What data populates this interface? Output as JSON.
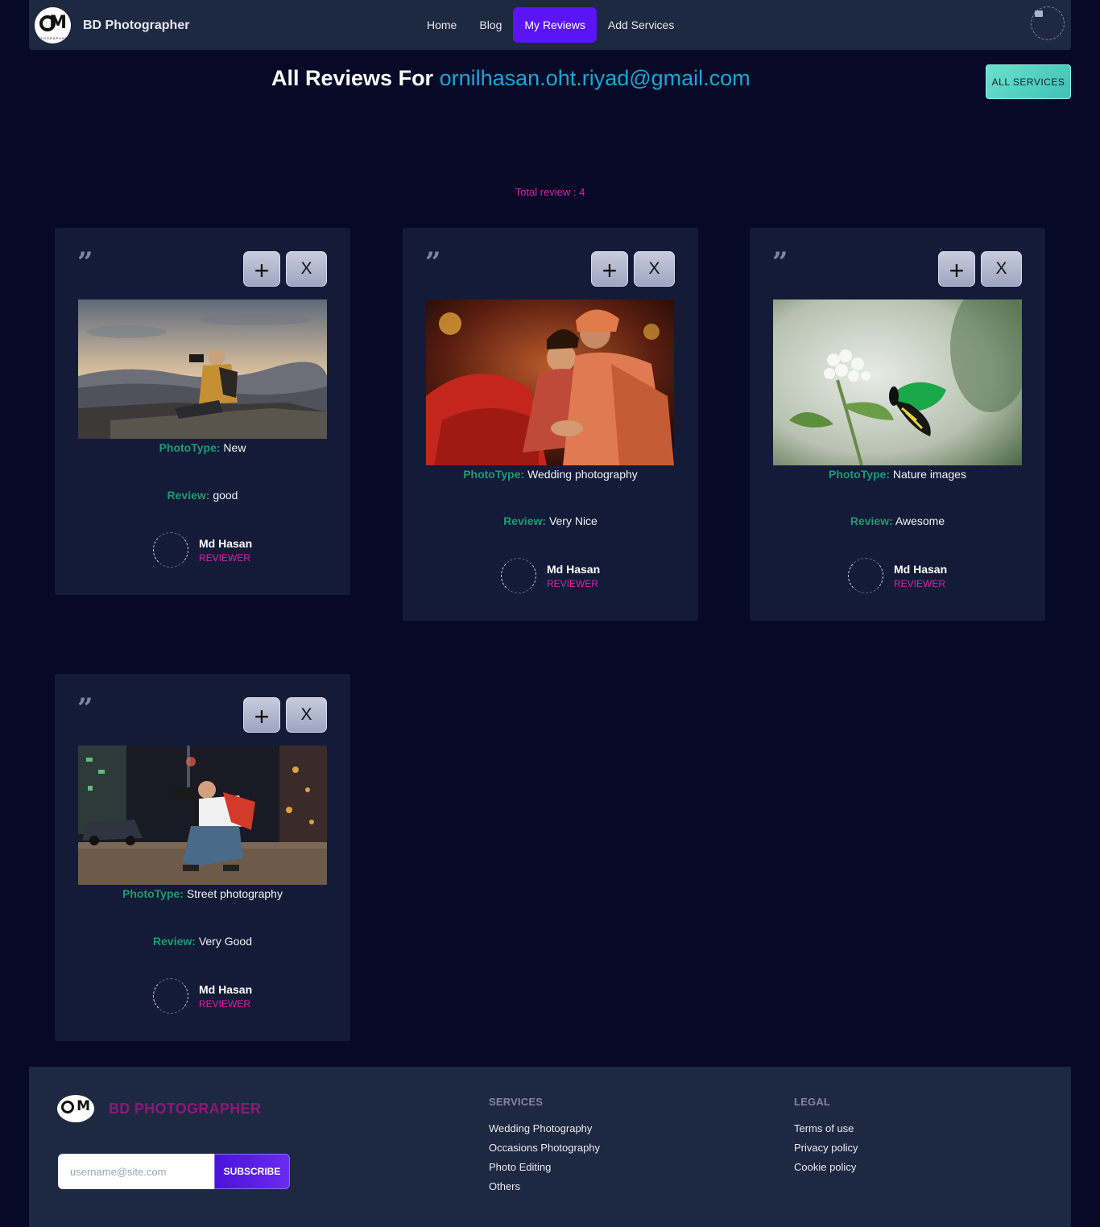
{
  "nav": {
    "brand": "BD Photographer",
    "logo_text": "M",
    "logo_sub": "OTOGRAPHER",
    "links": [
      {
        "label": "Home",
        "active": false
      },
      {
        "label": "Blog",
        "active": false
      },
      {
        "label": "My Reviews",
        "active": true
      },
      {
        "label": "Add Services",
        "active": false
      }
    ]
  },
  "header": {
    "title_prefix": "All Reviews For",
    "email": "ornilhasan.oht.riyad@gmail.com",
    "all_services_label": "ALL SERVICES"
  },
  "total_review": "Total review : 4",
  "labels": {
    "photo_type": "PhotoType:",
    "review": "Review:",
    "plus": "+",
    "close": "X",
    "quote": "”"
  },
  "reviews": [
    {
      "photo_type": "New",
      "review": "good",
      "reviewer": "Md Hasan",
      "role": "REVIEWER",
      "image": "mountain-photographer-icon"
    },
    {
      "photo_type": "Wedding photography",
      "review": "Very Nice",
      "reviewer": "Md Hasan",
      "role": "REVIEWER",
      "image": "wedding-couple-icon"
    },
    {
      "photo_type": "Nature images",
      "review": "Awesome",
      "reviewer": "Md Hasan",
      "role": "REVIEWER",
      "image": "butterfly-flower-icon"
    },
    {
      "photo_type": "Street photography",
      "review": "Very Good",
      "reviewer": "Md Hasan",
      "role": "REVIEWER",
      "image": "street-photographer-icon"
    }
  ],
  "footer": {
    "brand": "BD PHOTOGRAPHER",
    "subscribe_placeholder": "username@site.com",
    "subscribe_label": "SUBSCRIBE",
    "services_title": "SERVICES",
    "services": [
      "Wedding Photography",
      "Occasions Photography",
      "Photo Editing",
      "Others"
    ],
    "legal_title": "LEGAL",
    "legal": [
      "Terms of use",
      "Privacy policy",
      "Cookie policy"
    ]
  },
  "colors": {
    "background": "#070a27",
    "panel": "#1d2841",
    "card": "#131b38",
    "accent_purple": "#5a14f5",
    "email_blue": "#19a7d6",
    "label_green": "#1e9a74",
    "reviewer_pink": "#e020a8",
    "teal_button": "#4fd0c0"
  }
}
